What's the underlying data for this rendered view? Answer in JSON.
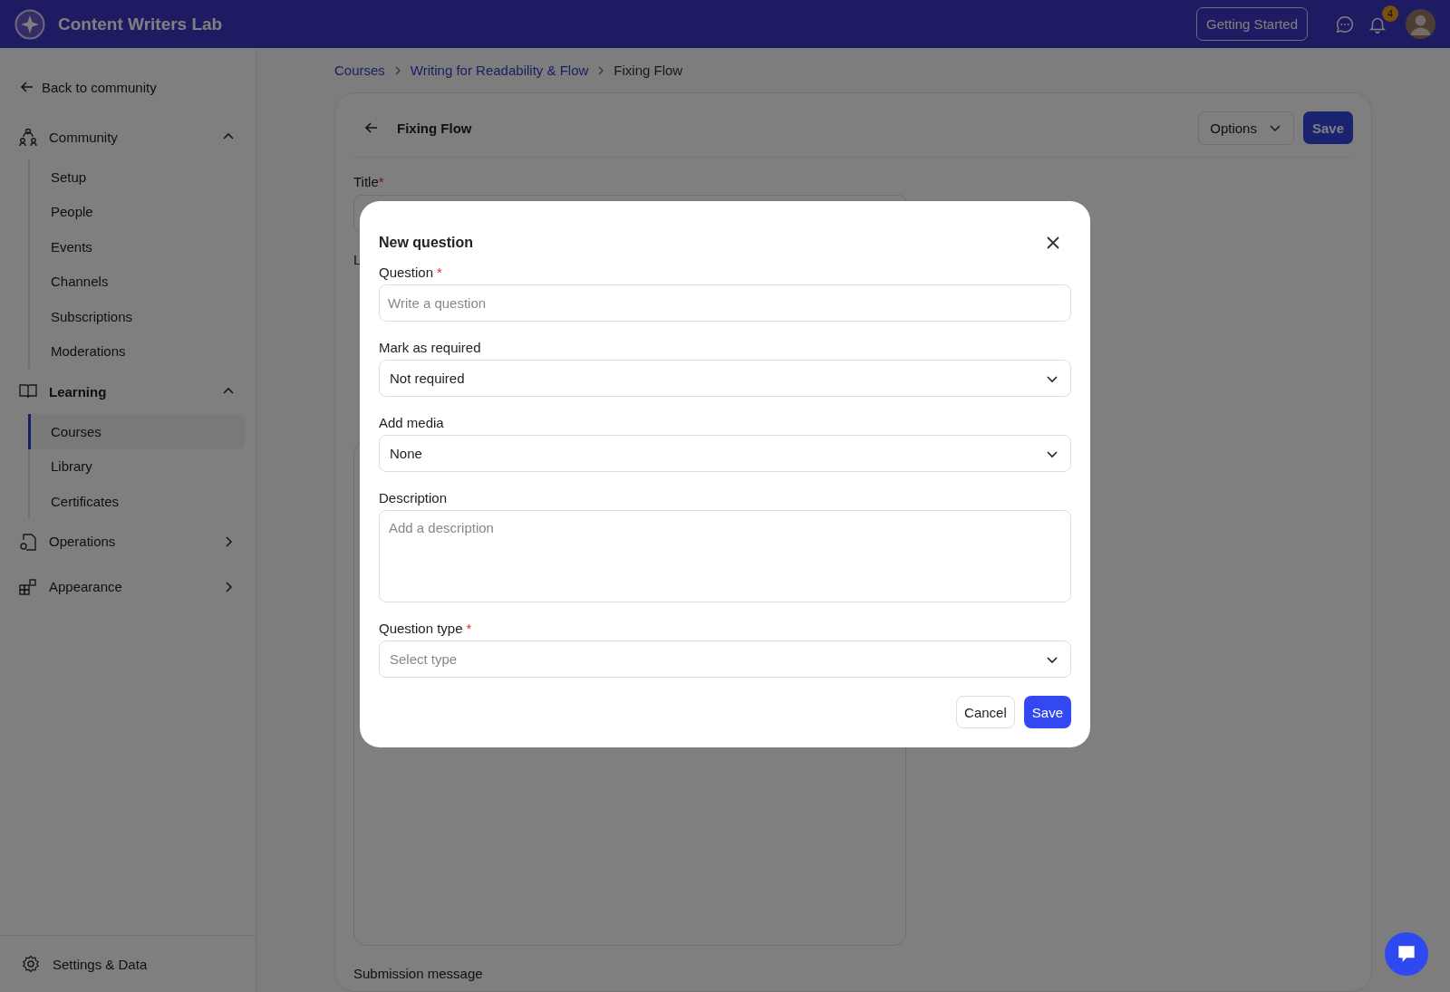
{
  "app": {
    "name": "Content Writers Lab"
  },
  "header": {
    "getting_started": "Getting Started",
    "notification_count": "4"
  },
  "sidebar": {
    "back": "Back to community",
    "groups": [
      {
        "label": "Community",
        "active": false,
        "expanded": true,
        "items": [
          {
            "label": "Setup",
            "selected": false
          },
          {
            "label": "People",
            "selected": false
          },
          {
            "label": "Events",
            "selected": false
          },
          {
            "label": "Channels",
            "selected": false
          },
          {
            "label": "Subscriptions",
            "selected": false
          },
          {
            "label": "Moderations",
            "selected": false
          }
        ]
      },
      {
        "label": "Learning",
        "active": true,
        "expanded": true,
        "items": [
          {
            "label": "Courses",
            "selected": true
          },
          {
            "label": "Library",
            "selected": false
          },
          {
            "label": "Certificates",
            "selected": false
          }
        ]
      },
      {
        "label": "Operations",
        "active": false,
        "expanded": false
      },
      {
        "label": "Appearance",
        "active": false,
        "expanded": false
      }
    ],
    "settings": "Settings & Data"
  },
  "breadcrumbs": [
    {
      "label": "Courses",
      "link": true
    },
    {
      "label": "Writing for Readability & Flow",
      "link": true
    },
    {
      "label": "Fixing Flow",
      "link": false
    }
  ],
  "page": {
    "title": "Fixing Flow",
    "options": "Options",
    "save": "Save",
    "title_label": "Title",
    "title_required_mark": "*",
    "hidden_labels": [
      "L"
    ],
    "submission_label": "Submission message"
  },
  "modal": {
    "title": "New question",
    "fields": [
      {
        "kind": "text",
        "label": "Question",
        "required_mark": "*",
        "placeholder": "Write a question"
      },
      {
        "kind": "select",
        "label": "Mark as required",
        "value": "Not required"
      },
      {
        "kind": "select",
        "label": "Add media",
        "value": "None"
      },
      {
        "kind": "textarea",
        "label": "Description",
        "placeholder": "Add a description"
      },
      {
        "kind": "select",
        "label": "Question type",
        "required_mark": "*",
        "placeholder": "Select type"
      }
    ],
    "cancel": "Cancel",
    "save": "Save"
  }
}
